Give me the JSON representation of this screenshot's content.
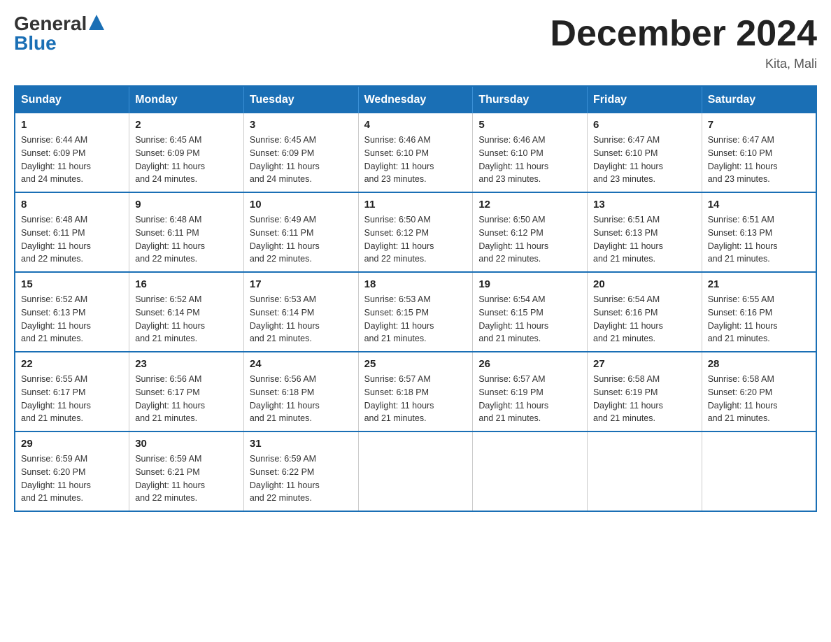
{
  "header": {
    "logo_general": "General",
    "logo_blue": "Blue",
    "month_title": "December 2024",
    "location": "Kita, Mali"
  },
  "weekdays": [
    "Sunday",
    "Monday",
    "Tuesday",
    "Wednesday",
    "Thursday",
    "Friday",
    "Saturday"
  ],
  "weeks": [
    [
      {
        "day": "1",
        "sunrise": "6:44 AM",
        "sunset": "6:09 PM",
        "daylight": "11 hours and 24 minutes."
      },
      {
        "day": "2",
        "sunrise": "6:45 AM",
        "sunset": "6:09 PM",
        "daylight": "11 hours and 24 minutes."
      },
      {
        "day": "3",
        "sunrise": "6:45 AM",
        "sunset": "6:09 PM",
        "daylight": "11 hours and 24 minutes."
      },
      {
        "day": "4",
        "sunrise": "6:46 AM",
        "sunset": "6:10 PM",
        "daylight": "11 hours and 23 minutes."
      },
      {
        "day": "5",
        "sunrise": "6:46 AM",
        "sunset": "6:10 PM",
        "daylight": "11 hours and 23 minutes."
      },
      {
        "day": "6",
        "sunrise": "6:47 AM",
        "sunset": "6:10 PM",
        "daylight": "11 hours and 23 minutes."
      },
      {
        "day": "7",
        "sunrise": "6:47 AM",
        "sunset": "6:10 PM",
        "daylight": "11 hours and 23 minutes."
      }
    ],
    [
      {
        "day": "8",
        "sunrise": "6:48 AM",
        "sunset": "6:11 PM",
        "daylight": "11 hours and 22 minutes."
      },
      {
        "day": "9",
        "sunrise": "6:48 AM",
        "sunset": "6:11 PM",
        "daylight": "11 hours and 22 minutes."
      },
      {
        "day": "10",
        "sunrise": "6:49 AM",
        "sunset": "6:11 PM",
        "daylight": "11 hours and 22 minutes."
      },
      {
        "day": "11",
        "sunrise": "6:50 AM",
        "sunset": "6:12 PM",
        "daylight": "11 hours and 22 minutes."
      },
      {
        "day": "12",
        "sunrise": "6:50 AM",
        "sunset": "6:12 PM",
        "daylight": "11 hours and 22 minutes."
      },
      {
        "day": "13",
        "sunrise": "6:51 AM",
        "sunset": "6:13 PM",
        "daylight": "11 hours and 21 minutes."
      },
      {
        "day": "14",
        "sunrise": "6:51 AM",
        "sunset": "6:13 PM",
        "daylight": "11 hours and 21 minutes."
      }
    ],
    [
      {
        "day": "15",
        "sunrise": "6:52 AM",
        "sunset": "6:13 PM",
        "daylight": "11 hours and 21 minutes."
      },
      {
        "day": "16",
        "sunrise": "6:52 AM",
        "sunset": "6:14 PM",
        "daylight": "11 hours and 21 minutes."
      },
      {
        "day": "17",
        "sunrise": "6:53 AM",
        "sunset": "6:14 PM",
        "daylight": "11 hours and 21 minutes."
      },
      {
        "day": "18",
        "sunrise": "6:53 AM",
        "sunset": "6:15 PM",
        "daylight": "11 hours and 21 minutes."
      },
      {
        "day": "19",
        "sunrise": "6:54 AM",
        "sunset": "6:15 PM",
        "daylight": "11 hours and 21 minutes."
      },
      {
        "day": "20",
        "sunrise": "6:54 AM",
        "sunset": "6:16 PM",
        "daylight": "11 hours and 21 minutes."
      },
      {
        "day": "21",
        "sunrise": "6:55 AM",
        "sunset": "6:16 PM",
        "daylight": "11 hours and 21 minutes."
      }
    ],
    [
      {
        "day": "22",
        "sunrise": "6:55 AM",
        "sunset": "6:17 PM",
        "daylight": "11 hours and 21 minutes."
      },
      {
        "day": "23",
        "sunrise": "6:56 AM",
        "sunset": "6:17 PM",
        "daylight": "11 hours and 21 minutes."
      },
      {
        "day": "24",
        "sunrise": "6:56 AM",
        "sunset": "6:18 PM",
        "daylight": "11 hours and 21 minutes."
      },
      {
        "day": "25",
        "sunrise": "6:57 AM",
        "sunset": "6:18 PM",
        "daylight": "11 hours and 21 minutes."
      },
      {
        "day": "26",
        "sunrise": "6:57 AM",
        "sunset": "6:19 PM",
        "daylight": "11 hours and 21 minutes."
      },
      {
        "day": "27",
        "sunrise": "6:58 AM",
        "sunset": "6:19 PM",
        "daylight": "11 hours and 21 minutes."
      },
      {
        "day": "28",
        "sunrise": "6:58 AM",
        "sunset": "6:20 PM",
        "daylight": "11 hours and 21 minutes."
      }
    ],
    [
      {
        "day": "29",
        "sunrise": "6:59 AM",
        "sunset": "6:20 PM",
        "daylight": "11 hours and 21 minutes."
      },
      {
        "day": "30",
        "sunrise": "6:59 AM",
        "sunset": "6:21 PM",
        "daylight": "11 hours and 22 minutes."
      },
      {
        "day": "31",
        "sunrise": "6:59 AM",
        "sunset": "6:22 PM",
        "daylight": "11 hours and 22 minutes."
      },
      null,
      null,
      null,
      null
    ]
  ],
  "labels": {
    "sunrise": "Sunrise:",
    "sunset": "Sunset:",
    "daylight": "Daylight:"
  }
}
